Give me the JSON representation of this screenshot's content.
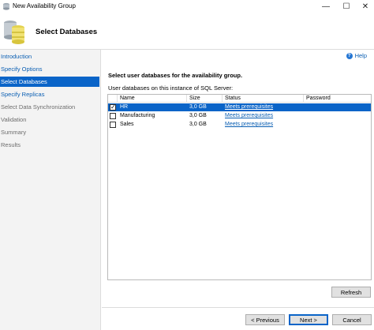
{
  "window": {
    "title": "New Availability Group"
  },
  "header": {
    "title": "Select Databases"
  },
  "sidebar": {
    "items": [
      {
        "label": "Introduction",
        "state": "link"
      },
      {
        "label": "Specify Options",
        "state": "link"
      },
      {
        "label": "Select Databases",
        "state": "active"
      },
      {
        "label": "Specify Replicas",
        "state": "link"
      },
      {
        "label": "Select Data Synchronization",
        "state": "disabled"
      },
      {
        "label": "Validation",
        "state": "disabled"
      },
      {
        "label": "Summary",
        "state": "disabled"
      },
      {
        "label": "Results",
        "state": "disabled"
      }
    ]
  },
  "main": {
    "help_label": "Help",
    "instruction": "Select user databases for the availability group.",
    "grid_caption": "User databases on this instance of SQL Server:",
    "columns": [
      "Name",
      "Size",
      "Status",
      "Password"
    ],
    "rows": [
      {
        "name": "HR",
        "size": "3,0 GB",
        "status": "Meets prerequisites",
        "password": "",
        "checked": true
      },
      {
        "name": "Manufacturing",
        "size": "3,0 GB",
        "status": "Meets prerequisites",
        "password": "",
        "checked": false
      },
      {
        "name": "Sales",
        "size": "3,0 GB",
        "status": "Meets prerequisites",
        "password": "",
        "checked": false
      }
    ],
    "refresh_label": "Refresh"
  },
  "footer": {
    "previous_label": "< Previous",
    "next_label": "Next >",
    "cancel_label": "Cancel"
  },
  "colors": {
    "accent": "#0a64c8",
    "link": "#0b5fb3"
  }
}
